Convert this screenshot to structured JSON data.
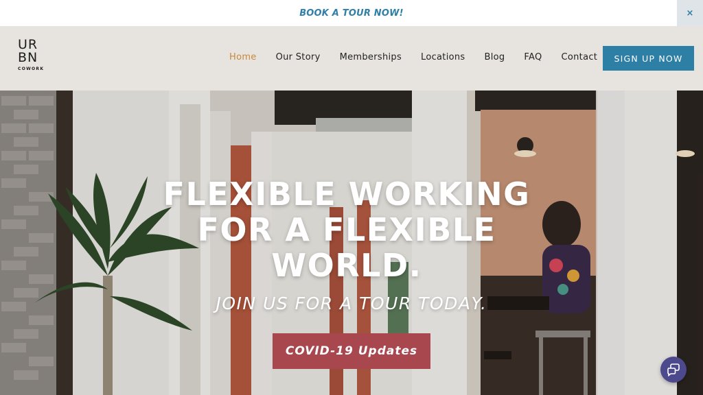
{
  "announcement": {
    "text": "BOOK A TOUR NOW!",
    "close_icon": "×"
  },
  "brand": {
    "logo_line1": "UR",
    "logo_line2": "BN",
    "logo_sub": "COWORK",
    "accent_color": "#c8742f"
  },
  "nav": {
    "items": [
      {
        "label": "Home",
        "active": true
      },
      {
        "label": "Our Story",
        "active": false
      },
      {
        "label": "Memberships",
        "active": false
      },
      {
        "label": "Locations",
        "active": false
      },
      {
        "label": "Blog",
        "active": false
      },
      {
        "label": "FAQ",
        "active": false
      },
      {
        "label": "Contact",
        "active": false
      }
    ],
    "signup_label": "SIGN UP NOW"
  },
  "hero": {
    "title_line1": "FLEXIBLE WORKING",
    "title_line2": "FOR A FLEXIBLE",
    "title_line3": "WORLD.",
    "subtitle": "JOIN US FOR A TOUR TODAY.",
    "cta_label": "COVID-19 Updates"
  },
  "colors": {
    "primary_blue": "#2e7fa6",
    "cta_red": "#a9474f",
    "nav_active": "#c9873b",
    "chat_purple": "#4c4a8c"
  },
  "icons": {
    "chat": "chat-bubbles-icon",
    "close": "close-icon"
  }
}
